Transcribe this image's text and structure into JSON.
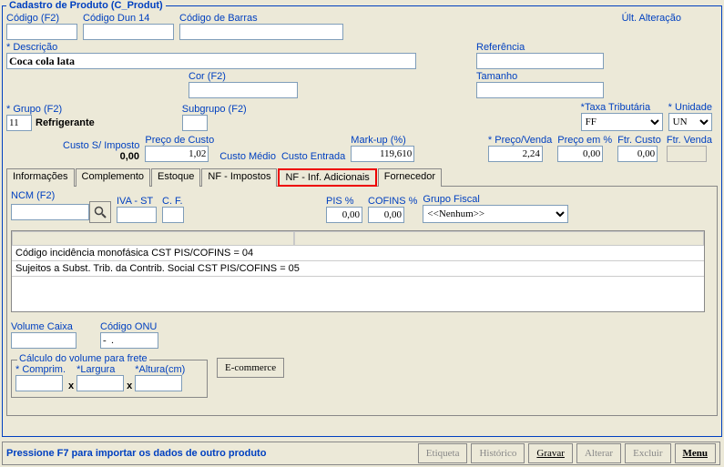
{
  "title": "Cadastro de Produto (C_Produt)",
  "labels": {
    "codigo": "Código (F2)",
    "dun": "Código Dun 14",
    "barras": "Código de Barras",
    "ultalt": "Últ. Alteração",
    "descricao": "* Descrição",
    "referencia": "Referência",
    "cor": "Cor (F2)",
    "tamanho": "Tamanho",
    "grupo": "* Grupo (F2)",
    "subgrupo": "Subgrupo (F2)",
    "taxa": "*Taxa Tributária",
    "unidade": "* Unidade",
    "custosi": "Custo S/ Imposto",
    "precocusto": "Preço de Custo",
    "customedio": "Custo Médio",
    "custoentrada": "Custo Entrada",
    "markup": "Mark-up (%)",
    "precovenda": "* Preço/Venda",
    "precopct": "Preço em %",
    "ftrcusto": "Ftr. Custo",
    "ftrvenda": "Ftr. Venda",
    "ncm": "NCM  (F2)",
    "ivast": "IVA - ST",
    "cf": "C. F.",
    "pis": "PIS %",
    "cofins": "COFINS %",
    "grupofiscal": "Grupo Fiscal",
    "volcaixa": "Volume Caixa",
    "onu": "Código ONU",
    "calcvol": "Cálculo do volume para frete",
    "comprim": "* Comprim.",
    "largura": "*Largura",
    "altura": "*Altura(cm)",
    "ecommerce": "E-commerce"
  },
  "values": {
    "descricao": "Coca cola lata",
    "grupo_cod": "11",
    "grupo_nome": "Refrigerante",
    "custosi": "0,00",
    "precocusto": "1,02",
    "markup": "119,610",
    "precovenda": "2,24",
    "precopct": "0,00",
    "ftrcusto": "0,00",
    "taxa": "FF",
    "unidade": "UN",
    "pis": "0,00",
    "cofins": "0,00",
    "grupofiscal": "<<Nenhum>>",
    "onu": "-  ."
  },
  "tabs": [
    "Informações",
    "Complemento",
    "Estoque",
    "NF - Impostos",
    "NF - Inf. Adicionais",
    "Fornecedor"
  ],
  "listrows": [
    "Código incidência monofásica CST PIS/COFINS = 04",
    "Sujeitos a Subst. Trib. da Contrib. Social CST PIS/COFINS = 05"
  ],
  "footer": {
    "msg": "Pressione F7 para importar os dados de outro produto",
    "buttons": [
      "Etiqueta",
      "Histórico",
      "Gravar",
      "Alterar",
      "Excluir",
      "Menu"
    ]
  }
}
